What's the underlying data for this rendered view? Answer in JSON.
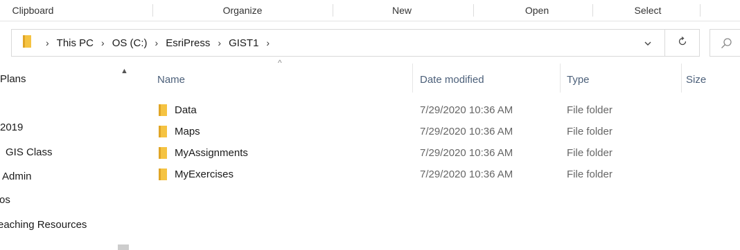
{
  "ribbon": {
    "groups": [
      "Clipboard",
      "Organize",
      "New",
      "Open",
      "Select"
    ]
  },
  "address": {
    "crumbs": [
      "This PC",
      "OS (C:)",
      "EsriPress",
      "GIST1"
    ],
    "dropdown_icon": "chevron-down-icon",
    "refresh_icon": "refresh-icon",
    "search_icon": "search-icon"
  },
  "nav": {
    "items": [
      "Plans",
      "2019",
      "GIS Class",
      "Admin",
      "os",
      "eaching Resources"
    ]
  },
  "columns": {
    "name": "Name",
    "date": "Date modified",
    "type": "Type",
    "size": "Size"
  },
  "files": [
    {
      "name": "Data",
      "date": "7/29/2020 10:36 AM",
      "type": "File folder"
    },
    {
      "name": "Maps",
      "date": "7/29/2020 10:36 AM",
      "type": "File folder"
    },
    {
      "name": "MyAssignments",
      "date": "7/29/2020 10:36 AM",
      "type": "File folder"
    },
    {
      "name": "MyExercises",
      "date": "7/29/2020 10:36 AM",
      "type": "File folder"
    }
  ],
  "colors": {
    "folder": "#f5c342",
    "folder_dark": "#e0a526",
    "header_text": "#4c607a"
  }
}
